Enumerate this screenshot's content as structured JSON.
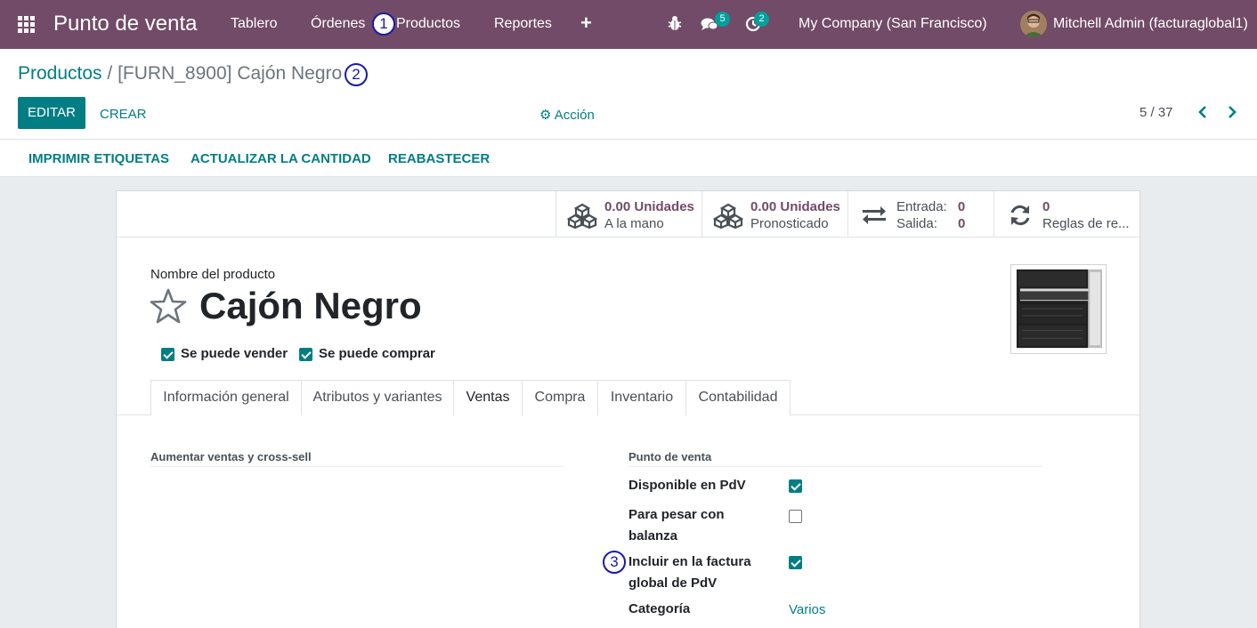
{
  "navbar": {
    "brand": "Punto de venta",
    "menu": [
      "Tablero",
      "Órdenes",
      "Productos",
      "Reportes"
    ],
    "messages_count": "5",
    "activities_count": "2",
    "company": "My Company (San Francisco)",
    "user": "Mitchell Admin (facturaglobal1)"
  },
  "markers": [
    "1",
    "2",
    "3"
  ],
  "breadcrumb": {
    "parent": "Productos",
    "separator": "/",
    "current": "[FURN_8900] Cajón Negro"
  },
  "buttons": {
    "edit": "EDITAR",
    "create": "CREAR",
    "action": "Acción"
  },
  "pager": "5 / 37",
  "actions": [
    "IMPRIMIR ETIQUETAS",
    "ACTUALIZAR LA CANTIDAD",
    "REABASTECER"
  ],
  "stats": {
    "on_hand_value": "0.00 Unidades",
    "on_hand_label": "A la mano",
    "forecast_value": "0.00 Unidades",
    "forecast_label": "Pronosticado",
    "in_label": "Entrada:",
    "in_value": "0",
    "out_label": "Salida:",
    "out_value": "0",
    "rules_value": "0",
    "rules_label": "Reglas de re..."
  },
  "product": {
    "name_label": "Nombre del producto",
    "name": "Cajón Negro",
    "can_sell_label": "Se puede vender",
    "can_sell": true,
    "can_buy_label": "Se puede comprar",
    "can_buy": true
  },
  "tabs": [
    "Información general",
    "Atributos y variantes",
    "Ventas",
    "Compra",
    "Inventario",
    "Contabilidad"
  ],
  "active_tab": "Ventas",
  "sales": {
    "upsell_title": "Aumentar ventas y cross-sell",
    "pos_title": "Punto de venta",
    "available_label": "Disponible en PdV",
    "available": true,
    "scale_label_1": "Para pesar con",
    "scale_label_2": "balanza",
    "scale": false,
    "global_invoice_label_1": "Incluir en la factura",
    "global_invoice_label_2": "global de PdV",
    "global_invoice": true,
    "category_label": "Categoría",
    "category_value": "Varios"
  },
  "colors": {
    "navbar": "#714b67",
    "primary": "#017e84",
    "badge": "#00a09d"
  }
}
